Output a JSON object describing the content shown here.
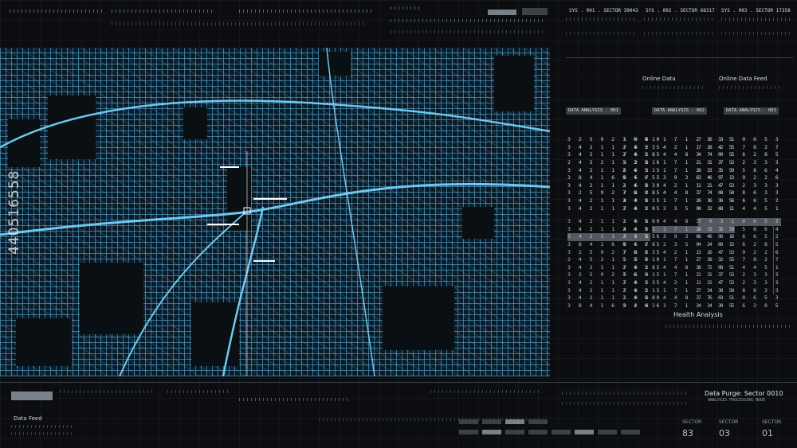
{
  "watermark": {
    "text": "440516558"
  },
  "systems": [
    {
      "label": "SYS . 001 . SECTOR 39042"
    },
    {
      "label": "SYS . 002 . SECTOR 68317"
    },
    {
      "label": "SYS . 003 . SECTOR 17358"
    }
  ],
  "feeds": {
    "online_data": "Online Data",
    "online_data_feed": "Online Data Feed",
    "data_feed_bottom": "Data Feed"
  },
  "analysis_tabs": [
    {
      "label": "DATA ANALYSIS . 001"
    },
    {
      "label": "DATA ANALYSIS . 002"
    },
    {
      "label": "DATA ANALYSIS . 003"
    }
  ],
  "columns": {
    "c1": [
      "3 2 5 9 2 7 6 8",
      "3 4 2 1 1 2 4 5",
      "3 4 2 1 1 2 4 5",
      "2 4 5 2 1 5 3 5",
      "3 4 2 1 1 2 4 5",
      "3 8 4 1 6 9 4 6",
      "3 4 2 1 1 2 4 5",
      "3 2 5 9 2 7 6 8",
      "3 4 2 1 1 2 4 5",
      "3 4 2 1 1 2 4 5"
    ],
    "c2": [
      "1 9 8 0",
      "7 8 2 5",
      "7 8 2 5",
      "3 2 8 6",
      "6 6 3 5",
      "6 5 7 5",
      "1 6 0 0",
      "7 8 2 5",
      "4 4 0 5",
      "7 8 2 5"
    ],
    "c3": [
      "1 1 7 1 2 3 3 5",
      "3 4 2 1 1 2 4 5",
      "8 4 4 8 3 7 0 5",
      "1 1 7 1 2 3 3 5",
      "1 1 7 1 2 3 3 5",
      "5 3 9 3 6 4 9 1",
      "3 4 2 1 1 2 4 5",
      "8 4 4 8 3 7 0 5",
      "1 1 7 1 2 3 3 5",
      "8 2 3 5 0 2 6 1"
    ],
    "c4": [
      "7 6 3 1 0 6 5 3",
      "7 8 2 5 7 8 2 7",
      "4 4 0 5 6 2 8 5",
      "1 1 7 3 2 3 3 3",
      "8 3 5 9 5 8 6 4",
      "3 6 7 3 9 2 2 6",
      "1 1 7 3 2 3 3 3",
      "7 4 8 0 8 6 3 3",
      "6 6 6 6 6 6 5 2",
      "8 2 8 1 4 4 5 1"
    ]
  },
  "health_analysis": "Health Analysis",
  "data_purge": "Data Purge: Sector 0010",
  "data_purge_sub": "ANALYSIS PROCESSING NODE",
  "sectors": [
    {
      "label": "SECTOR",
      "value": "83"
    },
    {
      "label": "SECTOR",
      "value": "03"
    },
    {
      "label": "SECTOR",
      "value": "01"
    }
  ],
  "colors": {
    "map_street": "#5fb9e6",
    "background": "#0b0d10"
  }
}
